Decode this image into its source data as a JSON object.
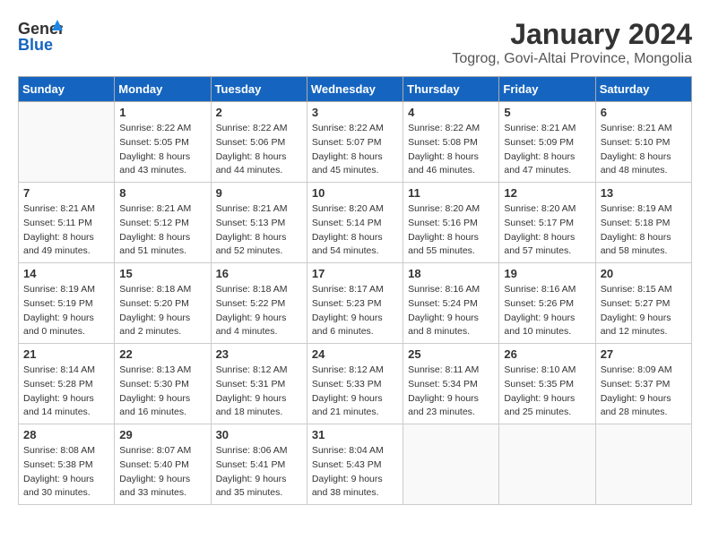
{
  "logo": {
    "line1": "General",
    "line2": "Blue"
  },
  "title": "January 2024",
  "subtitle": "Togrog, Govi-Altai Province, Mongolia",
  "days_header": [
    "Sunday",
    "Monday",
    "Tuesday",
    "Wednesday",
    "Thursday",
    "Friday",
    "Saturday"
  ],
  "weeks": [
    [
      {
        "day": "",
        "sunrise": "",
        "sunset": "",
        "daylight": ""
      },
      {
        "day": "1",
        "sunrise": "Sunrise: 8:22 AM",
        "sunset": "Sunset: 5:05 PM",
        "daylight": "Daylight: 8 hours and 43 minutes."
      },
      {
        "day": "2",
        "sunrise": "Sunrise: 8:22 AM",
        "sunset": "Sunset: 5:06 PM",
        "daylight": "Daylight: 8 hours and 44 minutes."
      },
      {
        "day": "3",
        "sunrise": "Sunrise: 8:22 AM",
        "sunset": "Sunset: 5:07 PM",
        "daylight": "Daylight: 8 hours and 45 minutes."
      },
      {
        "day": "4",
        "sunrise": "Sunrise: 8:22 AM",
        "sunset": "Sunset: 5:08 PM",
        "daylight": "Daylight: 8 hours and 46 minutes."
      },
      {
        "day": "5",
        "sunrise": "Sunrise: 8:21 AM",
        "sunset": "Sunset: 5:09 PM",
        "daylight": "Daylight: 8 hours and 47 minutes."
      },
      {
        "day": "6",
        "sunrise": "Sunrise: 8:21 AM",
        "sunset": "Sunset: 5:10 PM",
        "daylight": "Daylight: 8 hours and 48 minutes."
      }
    ],
    [
      {
        "day": "7",
        "sunrise": "Sunrise: 8:21 AM",
        "sunset": "Sunset: 5:11 PM",
        "daylight": "Daylight: 8 hours and 49 minutes."
      },
      {
        "day": "8",
        "sunrise": "Sunrise: 8:21 AM",
        "sunset": "Sunset: 5:12 PM",
        "daylight": "Daylight: 8 hours and 51 minutes."
      },
      {
        "day": "9",
        "sunrise": "Sunrise: 8:21 AM",
        "sunset": "Sunset: 5:13 PM",
        "daylight": "Daylight: 8 hours and 52 minutes."
      },
      {
        "day": "10",
        "sunrise": "Sunrise: 8:20 AM",
        "sunset": "Sunset: 5:14 PM",
        "daylight": "Daylight: 8 hours and 54 minutes."
      },
      {
        "day": "11",
        "sunrise": "Sunrise: 8:20 AM",
        "sunset": "Sunset: 5:16 PM",
        "daylight": "Daylight: 8 hours and 55 minutes."
      },
      {
        "day": "12",
        "sunrise": "Sunrise: 8:20 AM",
        "sunset": "Sunset: 5:17 PM",
        "daylight": "Daylight: 8 hours and 57 minutes."
      },
      {
        "day": "13",
        "sunrise": "Sunrise: 8:19 AM",
        "sunset": "Sunset: 5:18 PM",
        "daylight": "Daylight: 8 hours and 58 minutes."
      }
    ],
    [
      {
        "day": "14",
        "sunrise": "Sunrise: 8:19 AM",
        "sunset": "Sunset: 5:19 PM",
        "daylight": "Daylight: 9 hours and 0 minutes."
      },
      {
        "day": "15",
        "sunrise": "Sunrise: 8:18 AM",
        "sunset": "Sunset: 5:20 PM",
        "daylight": "Daylight: 9 hours and 2 minutes."
      },
      {
        "day": "16",
        "sunrise": "Sunrise: 8:18 AM",
        "sunset": "Sunset: 5:22 PM",
        "daylight": "Daylight: 9 hours and 4 minutes."
      },
      {
        "day": "17",
        "sunrise": "Sunrise: 8:17 AM",
        "sunset": "Sunset: 5:23 PM",
        "daylight": "Daylight: 9 hours and 6 minutes."
      },
      {
        "day": "18",
        "sunrise": "Sunrise: 8:16 AM",
        "sunset": "Sunset: 5:24 PM",
        "daylight": "Daylight: 9 hours and 8 minutes."
      },
      {
        "day": "19",
        "sunrise": "Sunrise: 8:16 AM",
        "sunset": "Sunset: 5:26 PM",
        "daylight": "Daylight: 9 hours and 10 minutes."
      },
      {
        "day": "20",
        "sunrise": "Sunrise: 8:15 AM",
        "sunset": "Sunset: 5:27 PM",
        "daylight": "Daylight: 9 hours and 12 minutes."
      }
    ],
    [
      {
        "day": "21",
        "sunrise": "Sunrise: 8:14 AM",
        "sunset": "Sunset: 5:28 PM",
        "daylight": "Daylight: 9 hours and 14 minutes."
      },
      {
        "day": "22",
        "sunrise": "Sunrise: 8:13 AM",
        "sunset": "Sunset: 5:30 PM",
        "daylight": "Daylight: 9 hours and 16 minutes."
      },
      {
        "day": "23",
        "sunrise": "Sunrise: 8:12 AM",
        "sunset": "Sunset: 5:31 PM",
        "daylight": "Daylight: 9 hours and 18 minutes."
      },
      {
        "day": "24",
        "sunrise": "Sunrise: 8:12 AM",
        "sunset": "Sunset: 5:33 PM",
        "daylight": "Daylight: 9 hours and 21 minutes."
      },
      {
        "day": "25",
        "sunrise": "Sunrise: 8:11 AM",
        "sunset": "Sunset: 5:34 PM",
        "daylight": "Daylight: 9 hours and 23 minutes."
      },
      {
        "day": "26",
        "sunrise": "Sunrise: 8:10 AM",
        "sunset": "Sunset: 5:35 PM",
        "daylight": "Daylight: 9 hours and 25 minutes."
      },
      {
        "day": "27",
        "sunrise": "Sunrise: 8:09 AM",
        "sunset": "Sunset: 5:37 PM",
        "daylight": "Daylight: 9 hours and 28 minutes."
      }
    ],
    [
      {
        "day": "28",
        "sunrise": "Sunrise: 8:08 AM",
        "sunset": "Sunset: 5:38 PM",
        "daylight": "Daylight: 9 hours and 30 minutes."
      },
      {
        "day": "29",
        "sunrise": "Sunrise: 8:07 AM",
        "sunset": "Sunset: 5:40 PM",
        "daylight": "Daylight: 9 hours and 33 minutes."
      },
      {
        "day": "30",
        "sunrise": "Sunrise: 8:06 AM",
        "sunset": "Sunset: 5:41 PM",
        "daylight": "Daylight: 9 hours and 35 minutes."
      },
      {
        "day": "31",
        "sunrise": "Sunrise: 8:04 AM",
        "sunset": "Sunset: 5:43 PM",
        "daylight": "Daylight: 9 hours and 38 minutes."
      },
      {
        "day": "",
        "sunrise": "",
        "sunset": "",
        "daylight": ""
      },
      {
        "day": "",
        "sunrise": "",
        "sunset": "",
        "daylight": ""
      },
      {
        "day": "",
        "sunrise": "",
        "sunset": "",
        "daylight": ""
      }
    ]
  ]
}
